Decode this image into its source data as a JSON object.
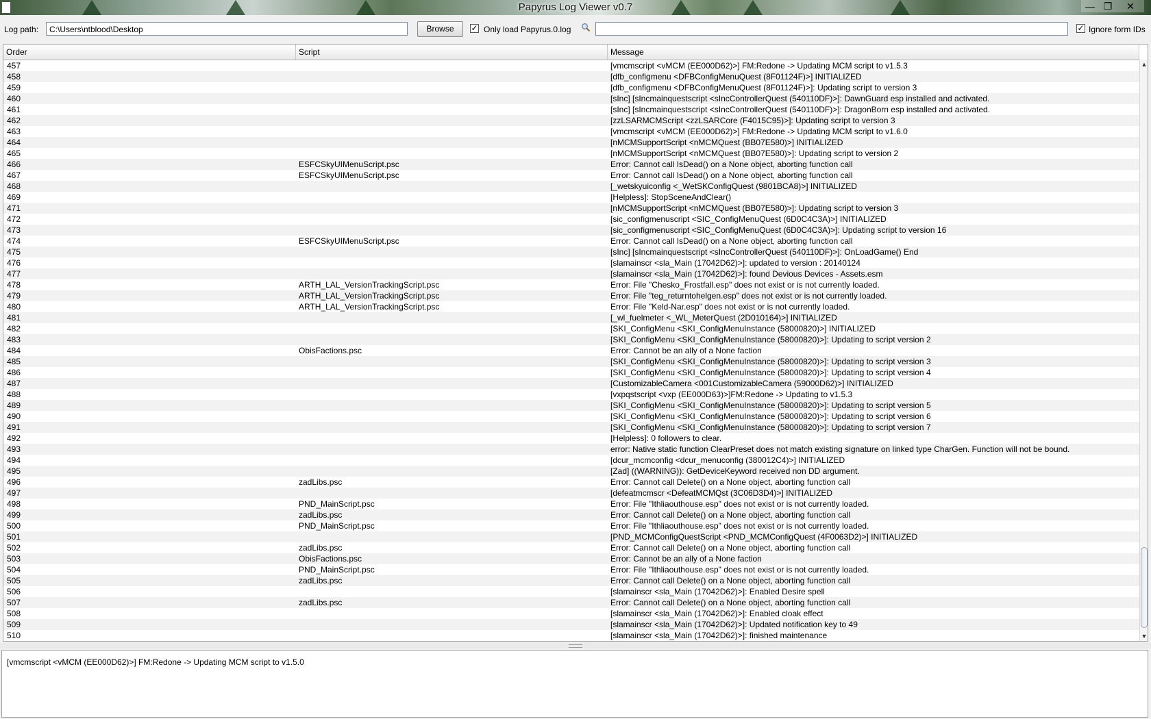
{
  "window": {
    "title": "Papyrus Log Viewer v0.7",
    "min": "—",
    "max": "❐",
    "close": "✕"
  },
  "toolbar": {
    "log_path_label": "Log path:",
    "log_path_value": "C:\\Users\\ntblood\\Desktop",
    "browse_label": "Browse",
    "only_load_checked": true,
    "only_load_label": "Only load Papyrus.0.log",
    "search_value": "",
    "ignore_form_ids_checked": true,
    "ignore_form_ids_label": "Ignore form IDs",
    "checkmark": "✓"
  },
  "table": {
    "columns": [
      "Order",
      "Script",
      "Message"
    ],
    "rows": [
      [
        "457",
        "",
        "[vmcmscript <vMCM (EE000D62)>] FM:Redone -> Updating MCM script to v1.5.3"
      ],
      [
        "458",
        "",
        "[dfb_configmenu <DFBConfigMenuQuest (8F01124F)>] INITIALIZED"
      ],
      [
        "459",
        "",
        "[dfb_configmenu <DFBConfigMenuQuest (8F01124F)>]: Updating script to version 3"
      ],
      [
        "460",
        "",
        "[sInc] [sIncmainquestscript <sIncControllerQuest (540110DF)>]: DawnGuard esp installed and activated."
      ],
      [
        "461",
        "",
        "[sInc] [sIncmainquestscript <sIncControllerQuest (540110DF)>]: DragonBorn esp installed and activated."
      ],
      [
        "462",
        "",
        "[zzLSARMCMScript <zzLSARCore (F4015C95)>]: Updating script to version 3"
      ],
      [
        "463",
        "",
        "[vmcmscript <vMCM (EE000D62)>] FM:Redone -> Updating MCM script to v1.6.0"
      ],
      [
        "464",
        "",
        "[nMCMSupportScript <nMCMQuest (BB07E580)>] INITIALIZED"
      ],
      [
        "465",
        "",
        "[nMCMSupportScript <nMCMQuest (BB07E580)>]: Updating script to version 2"
      ],
      [
        "466",
        "ESFCSkyUIMenuScript.psc",
        "Error: Cannot call IsDead() on a None object, aborting function call"
      ],
      [
        "467",
        "ESFCSkyUIMenuScript.psc",
        "Error: Cannot call IsDead() on a None object, aborting function call"
      ],
      [
        "468",
        "",
        "[_wetskyuiconfig <_WetSKConfigQuest (9801BCA8)>] INITIALIZED"
      ],
      [
        "469",
        "",
        "[Helpless]: StopSceneAndClear()"
      ],
      [
        "471",
        "",
        "[nMCMSupportScript <nMCMQuest (BB07E580)>]: Updating script to version 3"
      ],
      [
        "472",
        "",
        "[sic_configmenuscript <SIC_ConfigMenuQuest (6D0C4C3A)>] INITIALIZED"
      ],
      [
        "473",
        "",
        "[sic_configmenuscript <SIC_ConfigMenuQuest (6D0C4C3A)>]: Updating script to version 16"
      ],
      [
        "474",
        "ESFCSkyUIMenuScript.psc",
        "Error: Cannot call IsDead() on a None object, aborting function call"
      ],
      [
        "475",
        "",
        "[sInc] [sIncmainquestscript <sIncControllerQuest (540110DF)>]: OnLoadGame() End"
      ],
      [
        "476",
        "",
        "[slamainscr <sla_Main (17042D62)>]: updated to version : 20140124"
      ],
      [
        "477",
        "",
        "[slamainscr <sla_Main (17042D62)>]: found Devious Devices - Assets.esm"
      ],
      [
        "478",
        "ARTH_LAL_VersionTrackingScript.psc",
        "Error: File \"Chesko_Frostfall.esp\" does not exist or is not currently loaded."
      ],
      [
        "479",
        "ARTH_LAL_VersionTrackingScript.psc",
        "Error: File \"teg_returntohelgen.esp\" does not exist or is not currently loaded."
      ],
      [
        "480",
        "ARTH_LAL_VersionTrackingScript.psc",
        "Error: File \"Keld-Nar.esp\" does not exist or is not currently loaded."
      ],
      [
        "481",
        "",
        "[_wl_fuelmeter <_WL_MeterQuest (2D010164)>] INITIALIZED"
      ],
      [
        "482",
        "",
        "[SKI_ConfigMenu <SKI_ConfigMenuInstance (58000820)>] INITIALIZED"
      ],
      [
        "483",
        "",
        "[SKI_ConfigMenu <SKI_ConfigMenuInstance (58000820)>]: Updating to script version 2"
      ],
      [
        "484",
        "ObisFactions.psc",
        "Error: Cannot be an ally of a None faction"
      ],
      [
        "485",
        "",
        "[SKI_ConfigMenu <SKI_ConfigMenuInstance (58000820)>]: Updating to script version 3"
      ],
      [
        "486",
        "",
        "[SKI_ConfigMenu <SKI_ConfigMenuInstance (58000820)>]: Updating to script version 4"
      ],
      [
        "487",
        "",
        "[CustomizableCamera <001CustomizableCamera (59000D62)>] INITIALIZED"
      ],
      [
        "488",
        "",
        "[vxpqstscript <vxp (EE000D63)>]FM:Redone -> Updating to v1.5.3"
      ],
      [
        "489",
        "",
        "[SKI_ConfigMenu <SKI_ConfigMenuInstance (58000820)>]: Updating to script version 5"
      ],
      [
        "490",
        "",
        "[SKI_ConfigMenu <SKI_ConfigMenuInstance (58000820)>]: Updating to script version 6"
      ],
      [
        "491",
        "",
        "[SKI_ConfigMenu <SKI_ConfigMenuInstance (58000820)>]: Updating to script version 7"
      ],
      [
        "492",
        "",
        "[Helpless]: 0 followers to clear."
      ],
      [
        "493",
        "",
        "error: Native static function ClearPreset does not match existing signature on linked type CharGen. Function will not be bound."
      ],
      [
        "494",
        "",
        "[dcur_mcmconfig <dcur_menuconfig (380012C4)>] INITIALIZED"
      ],
      [
        "495",
        "",
        "[Zad] ((WARNING)): GetDeviceKeyword received non DD argument."
      ],
      [
        "496",
        "zadLibs.psc",
        "Error: Cannot call Delete() on a None object, aborting function call"
      ],
      [
        "497",
        "",
        "[defeatmcmscr <DefeatMCMQst (3C06D3D4)>] INITIALIZED"
      ],
      [
        "498",
        "PND_MainScript.psc",
        "Error: File \"Ithliaouthouse.esp\" does not exist or is not currently loaded."
      ],
      [
        "499",
        "zadLibs.psc",
        "Error: Cannot call Delete() on a None object, aborting function call"
      ],
      [
        "500",
        "PND_MainScript.psc",
        "Error: File \"Ithliaouthouse.esp\" does not exist or is not currently loaded."
      ],
      [
        "501",
        "",
        "[PND_MCMConfigQuestScript <PND_MCMConfigQuest (4F0063D2)>] INITIALIZED"
      ],
      [
        "502",
        "zadLibs.psc",
        "Error: Cannot call Delete() on a None object, aborting function call"
      ],
      [
        "503",
        "ObisFactions.psc",
        "Error: Cannot be an ally of a None faction"
      ],
      [
        "504",
        "PND_MainScript.psc",
        "Error: File \"Ithliaouthouse.esp\" does not exist or is not currently loaded."
      ],
      [
        "505",
        "zadLibs.psc",
        "Error: Cannot call Delete() on a None object, aborting function call"
      ],
      [
        "506",
        "",
        "[slamainscr <sla_Main (17042D62)>]: Enabled Desire spell"
      ],
      [
        "507",
        "zadLibs.psc",
        "Error: Cannot call Delete() on a None object, aborting function call"
      ],
      [
        "508",
        "",
        "[slamainscr <sla_Main (17042D62)>]: Enabled cloak effect"
      ],
      [
        "509",
        "",
        "[slamainscr <sla_Main (17042D62)>]: Updated notification key to 49"
      ],
      [
        "510",
        "",
        "[slamainscr <sla_Main (17042D62)>]: finished maintenance"
      ]
    ]
  },
  "scrollbar": {
    "up_arrow": "▲",
    "down_arrow": "▼"
  },
  "detail": {
    "text": "[vmcmscript <vMCM (EE000D62)>] FM:Redone -> Updating MCM script to v1.5.0"
  },
  "icons": {
    "search": "magnifier-icon",
    "app": "java-app-icon"
  }
}
